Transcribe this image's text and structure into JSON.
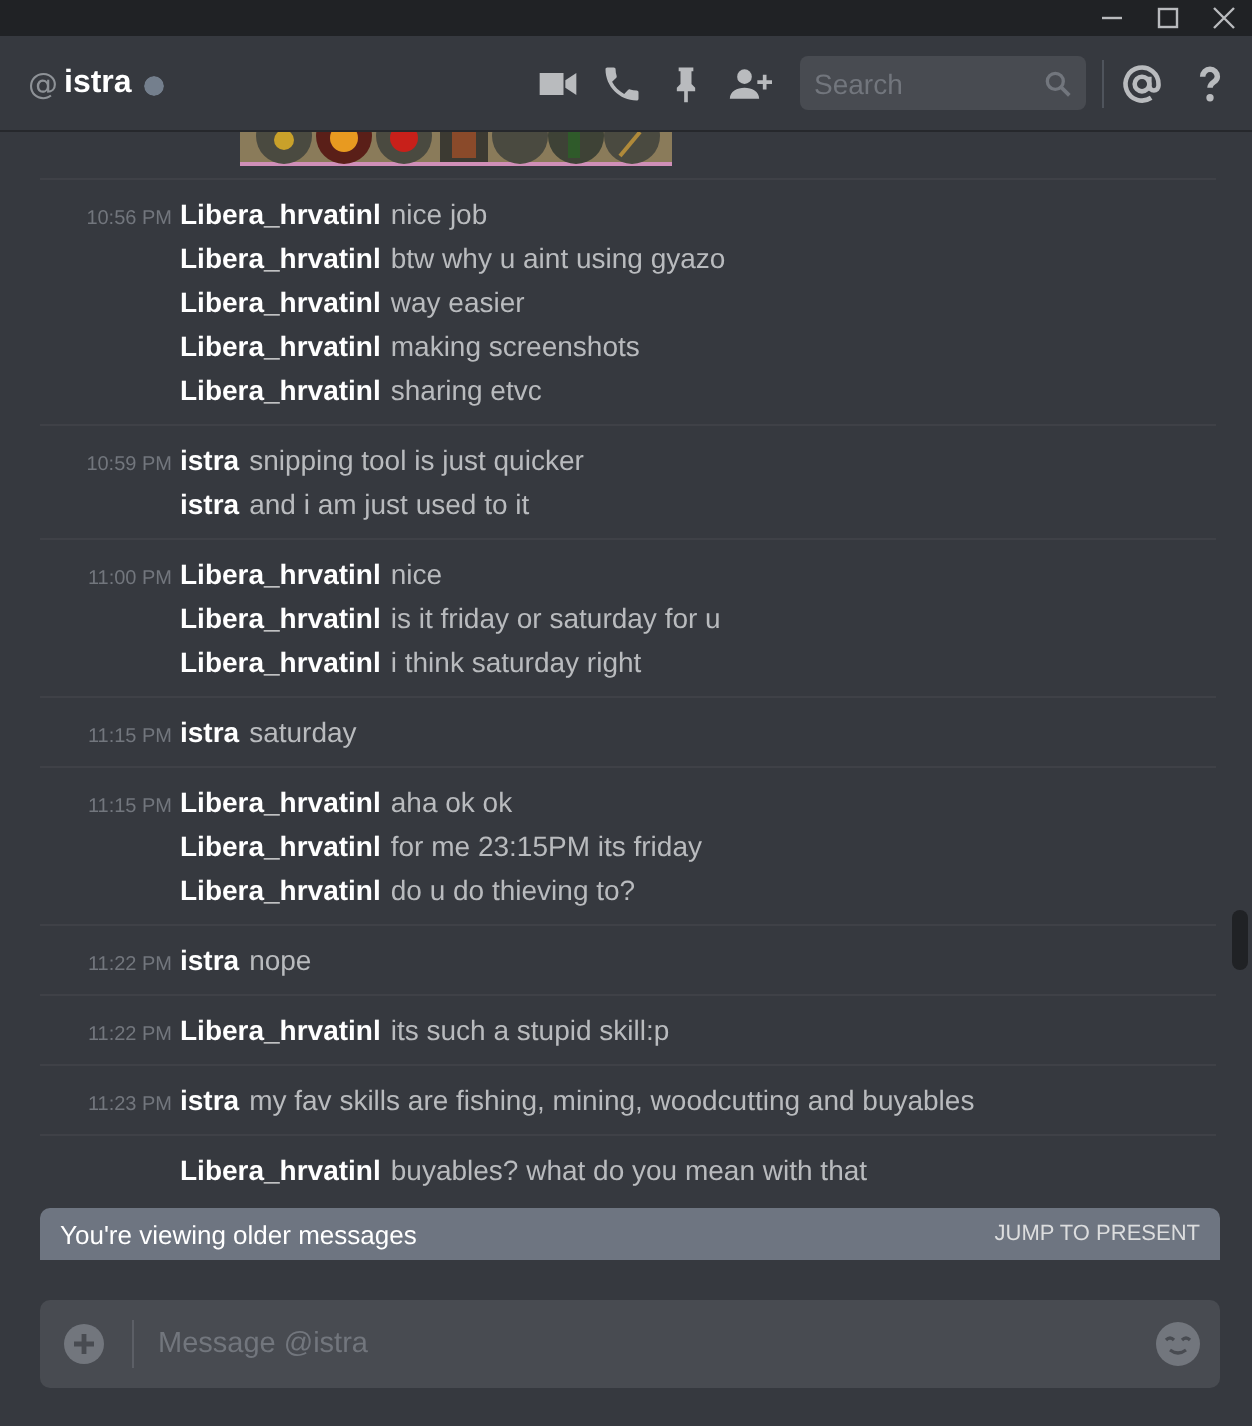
{
  "channel": {
    "prefix": "@",
    "name": "istra"
  },
  "search": {
    "placeholder": "Search"
  },
  "groups": [
    {
      "time": "10:56 PM",
      "messages": [
        {
          "author": "Libera_hrvatinl",
          "text": "nice job"
        },
        {
          "author": "Libera_hrvatinl",
          "text": "btw why u aint using gyazo"
        },
        {
          "author": "Libera_hrvatinl",
          "text": "way easier"
        },
        {
          "author": "Libera_hrvatinl",
          "text": "making screenshots"
        },
        {
          "author": "Libera_hrvatinl",
          "text": "sharing etvc"
        }
      ]
    },
    {
      "time": "10:59 PM",
      "messages": [
        {
          "author": "istra",
          "text": "snipping tool is just quicker"
        },
        {
          "author": "istra",
          "text": "and i am just used to it"
        }
      ]
    },
    {
      "time": "11:00 PM",
      "messages": [
        {
          "author": "Libera_hrvatinl",
          "text": "nice"
        },
        {
          "author": "Libera_hrvatinl",
          "text": "is it friday or saturday for u"
        },
        {
          "author": "Libera_hrvatinl",
          "text": "i think saturday right"
        }
      ]
    },
    {
      "time": "11:15 PM",
      "messages": [
        {
          "author": "istra",
          "text": "saturday"
        }
      ]
    },
    {
      "time": "11:15 PM",
      "messages": [
        {
          "author": "Libera_hrvatinl",
          "text": "aha ok ok"
        },
        {
          "author": "Libera_hrvatinl",
          "text": "for me 23:15PM its friday"
        },
        {
          "author": "Libera_hrvatinl",
          "text": "do u do thieving to?"
        }
      ]
    },
    {
      "time": "11:22 PM",
      "messages": [
        {
          "author": "istra",
          "text": "nope"
        }
      ]
    },
    {
      "time": "11:22 PM",
      "messages": [
        {
          "author": "Libera_hrvatinl",
          "text": "its such a stupid skill:p"
        }
      ]
    },
    {
      "time": "11:23 PM",
      "messages": [
        {
          "author": "istra",
          "text": "my fav skills are fishing, mining, woodcutting and buyables"
        }
      ]
    },
    {
      "messages": [
        {
          "author": "Libera_hrvatinl",
          "text": "buyables? what do you mean with that"
        }
      ]
    }
  ],
  "banner": {
    "text": "You're viewing older messages",
    "action": "JUMP TO PRESENT"
  },
  "composer": {
    "placeholder": "Message @istra"
  }
}
